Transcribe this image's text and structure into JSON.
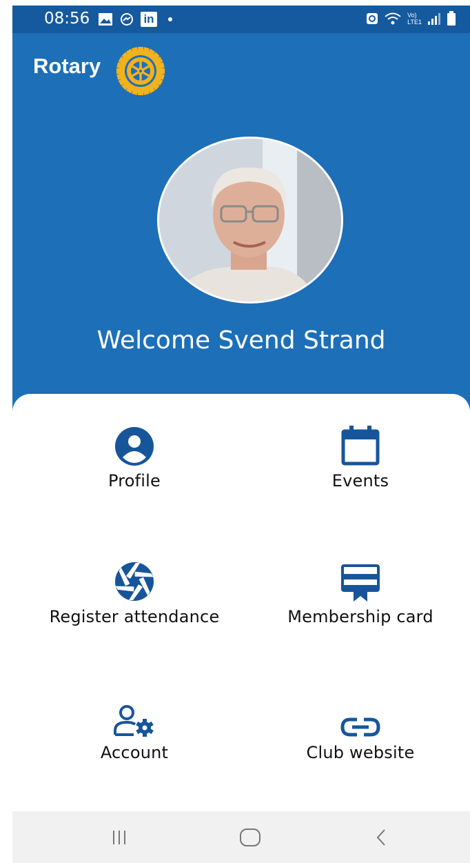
{
  "status_bar": {
    "time": "08:56",
    "left_icons": [
      "gallery-icon",
      "messenger-icon",
      "linkedin-icon",
      "dot-icon"
    ],
    "linkedin_text": "in",
    "right_icons": [
      "nfc-icon",
      "wifi-icon",
      "volte-icon",
      "signal-icon",
      "battery-icon"
    ],
    "volte_top": "Vo)",
    "volte_bottom": "LTE1"
  },
  "header": {
    "logo_text": "Rotary",
    "logo_icon": "rotary-wheel-icon",
    "welcome_text": "Welcome Svend Strand"
  },
  "menu": {
    "items": [
      {
        "label": "Profile",
        "icon": "profile-icon"
      },
      {
        "label": "Events",
        "icon": "calendar-icon"
      },
      {
        "label": "Register attendance",
        "icon": "camera-shutter-icon"
      },
      {
        "label": "Membership card",
        "icon": "membership-card-icon"
      },
      {
        "label": "Account",
        "icon": "account-settings-icon"
      },
      {
        "label": "Club website",
        "icon": "link-icon"
      }
    ]
  },
  "nav_bar": {
    "buttons": [
      "recent-apps-icon",
      "home-icon",
      "back-icon"
    ]
  },
  "colors": {
    "header_blue": "#1d6fb8",
    "status_blue": "#15599e",
    "icon_blue": "#17559b",
    "rotary_gold": "#f2b21b"
  }
}
